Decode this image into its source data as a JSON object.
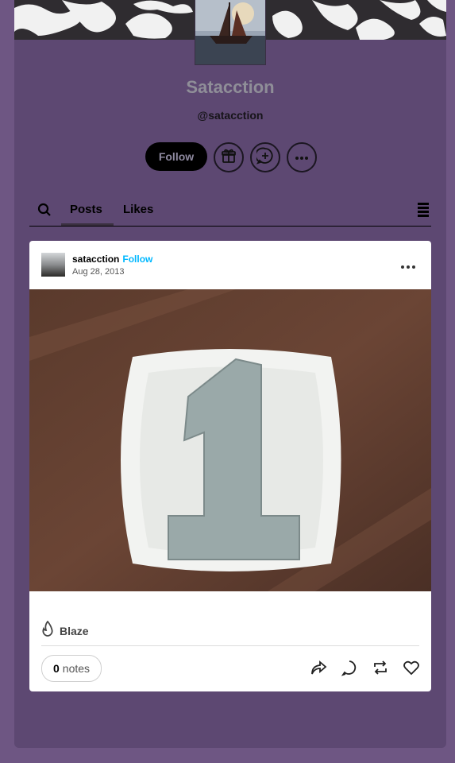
{
  "blog": {
    "title": "Satacction",
    "handle": "@satacction",
    "follow_label": "Follow"
  },
  "tabs": {
    "posts": "Posts",
    "likes": "Likes"
  },
  "post": {
    "author": "satacction",
    "follow_label": "Follow",
    "date": "Aug 28, 2013",
    "blaze_label": "Blaze",
    "notes_count": "0",
    "notes_label": "notes"
  },
  "icons": [
    "gift-icon",
    "add-chat-icon",
    "more-icon",
    "search-icon",
    "layout-icon",
    "more-horizontal-icon",
    "flame-icon",
    "share-icon",
    "reply-icon",
    "reblog-icon",
    "heart-icon"
  ],
  "colors": {
    "page_bg": "#6e5683",
    "panel_bg": "#5d4872",
    "follow_link": "#00b8ff"
  }
}
